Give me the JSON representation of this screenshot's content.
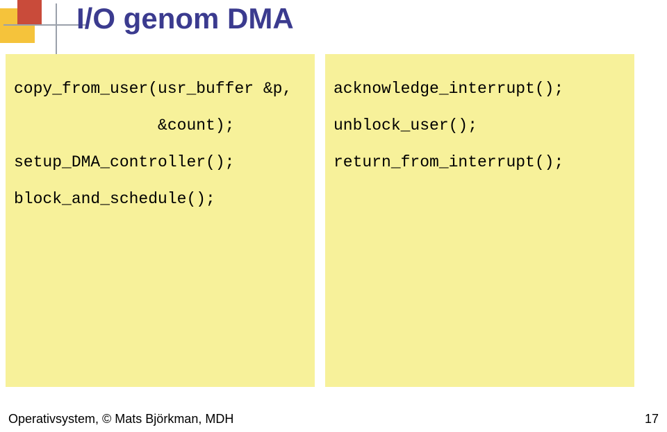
{
  "slide": {
    "title": "I/O genom DMA"
  },
  "codeLeft": {
    "line1": "copy_from_user(usr_buffer &p,",
    "line2": "               &count);",
    "line3": "setup_DMA_controller();",
    "line4": "block_and_schedule();"
  },
  "codeRight": {
    "line1": "acknowledge_interrupt();",
    "line2": "unblock_user();",
    "line3": "return_from_interrupt();"
  },
  "footer": {
    "text": "Operativsystem, © Mats Björkman, MDH",
    "page": "17"
  }
}
